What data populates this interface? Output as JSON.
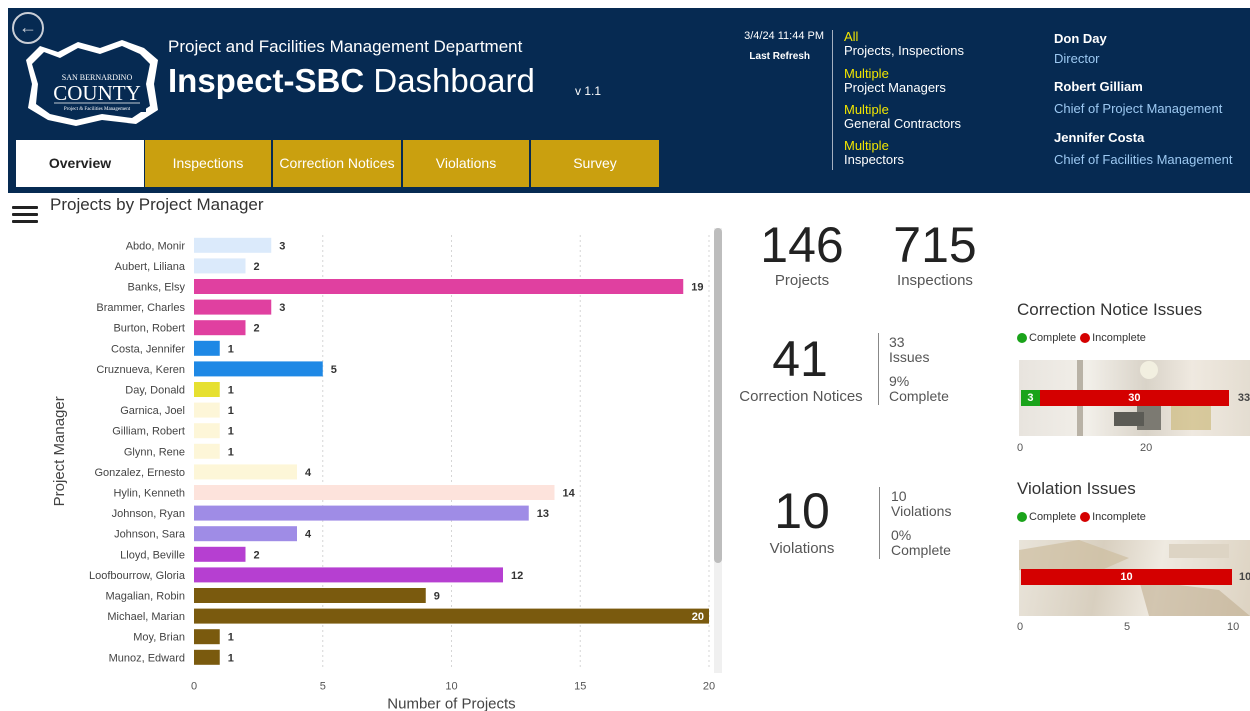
{
  "header": {
    "department": "Project and Facilities Management Department",
    "title_bold": "Inspect-SBC",
    "title_rest": "Dashboard",
    "version": "v 1.1",
    "logo_line1": "SAN BERNARDINO",
    "logo_line2": "COUNTY",
    "logo_line3": "Project & Facilities Management",
    "refresh_date": "3/4/24 11:44 PM",
    "refresh_label": "Last Refresh"
  },
  "tabs": [
    {
      "label": "Overview",
      "active": true
    },
    {
      "label": "Inspections"
    },
    {
      "label": "Correction Notices"
    },
    {
      "label": "Violations"
    },
    {
      "label": "Survey"
    }
  ],
  "filters": [
    {
      "value": "All",
      "label": "Projects, Inspections"
    },
    {
      "value": "Multiple",
      "label": "Project Managers"
    },
    {
      "value": "Multiple",
      "label": "General Contractors"
    },
    {
      "value": "Multiple",
      "label": "Inspectors"
    }
  ],
  "people": [
    {
      "name": "Don Day",
      "role": "Director"
    },
    {
      "name": "Robert Gilliam",
      "role": "Chief of Project Management"
    },
    {
      "name": "Jennifer Costa",
      "role": "Chief of Facilities Management"
    }
  ],
  "chart_title": "Projects by Project Manager",
  "chart_data": {
    "type": "bar",
    "orientation": "horizontal",
    "categories": [
      "Abdo, Monir",
      "Aubert, Liliana",
      "Banks, Elsy",
      "Brammer, Charles",
      "Burton, Robert",
      "Costa, Jennifer",
      "Cruznueva, Keren",
      "Day, Donald",
      "Garnica, Joel",
      "Gilliam, Robert",
      "Glynn, Rene",
      "Gonzalez, Ernesto",
      "Hylin, Kenneth",
      "Johnson, Ryan",
      "Johnson, Sara",
      "Lloyd, Beville",
      "Loofbourrow, Gloria",
      "Magalian, Robin",
      "Michael, Marian",
      "Moy, Brian",
      "Munoz, Edward"
    ],
    "values": [
      3,
      2,
      19,
      3,
      2,
      1,
      5,
      1,
      1,
      1,
      1,
      4,
      14,
      13,
      4,
      2,
      12,
      9,
      20,
      1,
      1
    ],
    "colors": [
      "#dbeafb",
      "#dbeafb",
      "#e040a0",
      "#e040a0",
      "#e040a0",
      "#1e88e5",
      "#1e88e5",
      "#e6e030",
      "#fdf6d8",
      "#fdf6d8",
      "#fdf6d8",
      "#fdf6d8",
      "#fde3dc",
      "#9f8ce6",
      "#9f8ce6",
      "#b63fd1",
      "#b63fd1",
      "#7a5a0e",
      "#7a5a0e",
      "#7a5a0e",
      "#7a5a0e"
    ],
    "xlabel": "Number of Projects",
    "ylabel": "Project Manager",
    "xticks": [
      0,
      5,
      10,
      15,
      20
    ],
    "xlim": [
      0,
      20
    ]
  },
  "kpis": {
    "projects": {
      "value": "146",
      "label": "Projects"
    },
    "inspections": {
      "value": "715",
      "label": "Inspections"
    },
    "correction_notices": {
      "value": "41",
      "label": "Correction Notices",
      "issues_value": "33",
      "issues_label": "Issues",
      "pct_value": "9%",
      "pct_label": "Complete"
    },
    "violations": {
      "value": "10",
      "label": "Violations",
      "count_value": "10",
      "count_label": "Violations",
      "pct_value": "0%",
      "pct_label": "Complete"
    }
  },
  "legend": {
    "complete": "Complete",
    "incomplete": "Incomplete",
    "complete_color": "#1aa31a",
    "incomplete_color": "#d40000"
  },
  "correction_issues": {
    "title": "Correction Notice Issues",
    "complete": 3,
    "incomplete": 30,
    "total": 33,
    "complete_label": "3",
    "incomplete_label": "30",
    "total_label": "33",
    "xticks": [
      "0",
      "20"
    ]
  },
  "violation_issues": {
    "title": "Violation Issues",
    "complete": 0,
    "incomplete": 10,
    "total": 10,
    "incomplete_label": "10",
    "total_label": "10",
    "xticks": [
      "0",
      "5",
      "10"
    ]
  }
}
